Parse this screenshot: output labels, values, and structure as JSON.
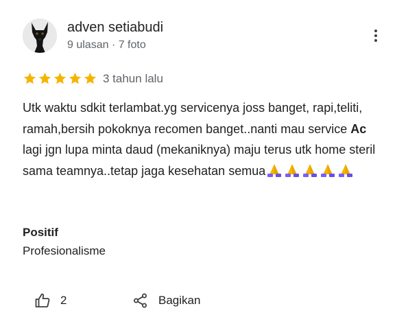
{
  "reviewer": {
    "name": "adven setiabudi",
    "meta": "9 ulasan · 7 foto"
  },
  "rating": {
    "stars": 5,
    "max": 5,
    "time": "3 tahun lalu",
    "star_color": "#f5b400"
  },
  "review": {
    "text_before": "Utk waktu sdkit terlambat.yg servicenya joss banget, rapi,teliti, ramah,bersih pokoknya recomen banget..nanti mau service ",
    "highlight": "Ac",
    "text_after": " lagi jgn lupa minta daud (mekaniknya) maju terus utk home steril sama teamnya..tetap jaga kesehatan semua",
    "emoji": [
      "folded-hands",
      "folded-hands",
      "folded-hands",
      "folded-hands",
      "folded-hands"
    ]
  },
  "tag": {
    "title": "Positif",
    "value": "Profesionalisme"
  },
  "actions": {
    "like_count": "2",
    "share_label": "Bagikan"
  },
  "icons": {
    "menu": "more-vert-icon",
    "like": "thumb-up-icon",
    "share": "share-icon"
  }
}
